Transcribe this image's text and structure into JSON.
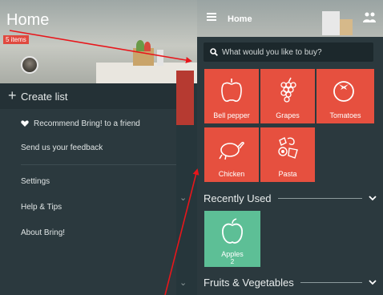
{
  "drawer": {
    "title": "Home",
    "item_count": "5 items",
    "create_list_label": "Create list",
    "menu": [
      {
        "label": "Recommend Bring! to a friend",
        "icon": "heart-icon"
      },
      {
        "label": "Send us your feedback"
      },
      {
        "label": "Settings"
      },
      {
        "label": "Help & Tips"
      },
      {
        "label": "About Bring!"
      }
    ]
  },
  "main": {
    "title": "Home",
    "search_placeholder": "What would you like to buy?",
    "catalog": [
      {
        "label": "Bell pepper",
        "icon": "bell-pepper-icon"
      },
      {
        "label": "Grapes",
        "icon": "grapes-icon"
      },
      {
        "label": "Tomatoes",
        "icon": "tomato-icon"
      },
      {
        "label": "Chicken",
        "icon": "chicken-icon"
      },
      {
        "label": "Pasta",
        "icon": "pasta-icon"
      }
    ],
    "recently_used": {
      "label": "Recently Used",
      "items": [
        {
          "label": "Apples",
          "qty": "2",
          "icon": "apple-icon"
        }
      ]
    },
    "fruits_section_label": "Fruits & Vegetables"
  },
  "colors": {
    "accent_red": "#e6503f",
    "accent_green": "#5dbf96",
    "panel_dark": "#2b393e",
    "annotation_arrow": "#e8161b"
  }
}
